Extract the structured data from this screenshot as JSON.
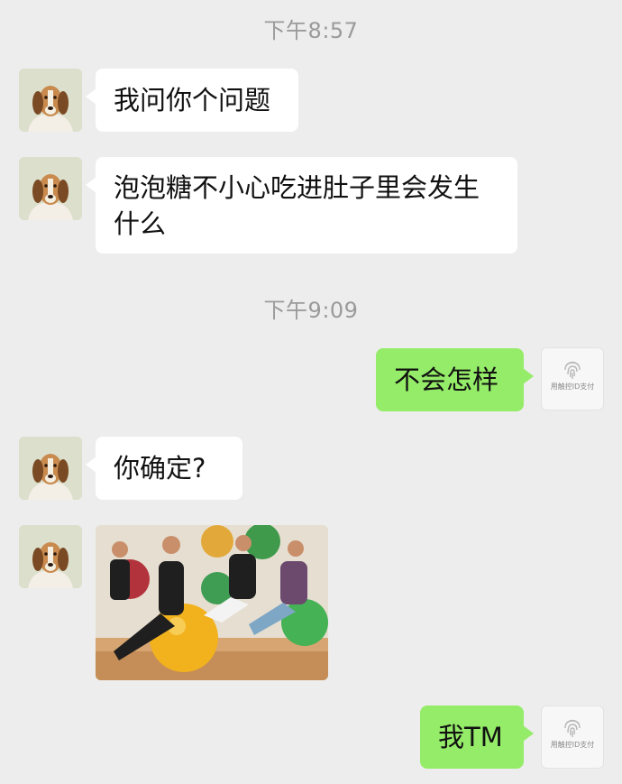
{
  "chat": {
    "time_1": "下午8:57",
    "time_2": "下午9:09",
    "messages": [
      {
        "side": "incoming",
        "text": "我问你个问题"
      },
      {
        "side": "incoming",
        "text": "泡泡糖不小心吃进肚子里会发生什么"
      },
      {
        "side": "outgoing",
        "text": "不会怎样"
      },
      {
        "side": "incoming",
        "text": "你确定?"
      },
      {
        "side": "incoming",
        "type": "image",
        "image": "people-sitting-on-exercise-balls-photo"
      },
      {
        "side": "outgoing",
        "text": "我TM"
      }
    ],
    "self_avatar_caption": "用触控ID支付"
  },
  "colors": {
    "background": "#ededed",
    "incoming_bubble": "#ffffff",
    "outgoing_bubble": "#95ec69",
    "timestamp": "#9a9a9a"
  },
  "icons": {
    "contact_avatar": "beagle-dog-avatar",
    "self_avatar": "fingerprint-icon"
  }
}
